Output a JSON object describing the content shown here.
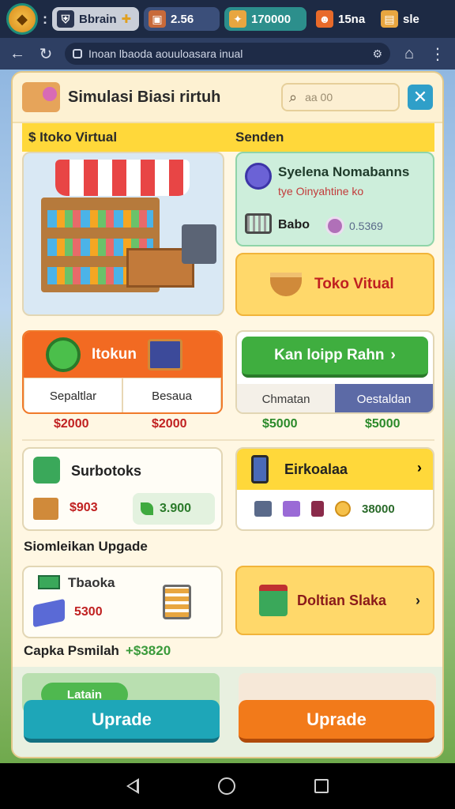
{
  "status_bar": {
    "resource_1": "Bbrain",
    "resource_2": "2.56",
    "resource_3": "170000",
    "resource_4": "15na",
    "resource_5": "sle"
  },
  "browser": {
    "url": "Inoan lbaoda aouuloasara inual"
  },
  "panel": {
    "title": "Simulasi Biasi rirtuh",
    "search_placeholder": "aa 00",
    "section_left": "$ Itoko Virtual",
    "section_right": "Senden"
  },
  "supplier": {
    "title": "Syelena Nomabanns",
    "subtitle": "tye Oinyahtine ko",
    "label": "Babo",
    "value": "0.5369"
  },
  "toko_card": {
    "label": "Toko Vitual"
  },
  "orange_card": {
    "title": "Itokun",
    "left_label": "Sepaltlar",
    "right_label": "Besaua",
    "left_price": "$2000",
    "right_price": "$2000"
  },
  "green_card": {
    "button_label": "Kan loipp Rahn",
    "tab_left": "Chmatan",
    "tab_right": "Oestaldan",
    "left_price": "$5000",
    "right_price": "$5000"
  },
  "subtotal_card": {
    "title": "Surbotoks",
    "price_red": "$903",
    "price_green": "3.900"
  },
  "yellow_card": {
    "title": "Eirkoalaa",
    "value": "38000"
  },
  "upgrade_section": {
    "label": "Siomleikan Upgade"
  },
  "tb_card": {
    "title": "Tbaoka",
    "price": "5300"
  },
  "dl_card": {
    "label": "Doltian Slaka"
  },
  "capka": {
    "label": "Capka Psmilah",
    "value": "+$3820"
  },
  "bottom": {
    "chip": "Latain",
    "left_button": "Uprade",
    "right_button": "Uprade"
  },
  "colors": {
    "accent_orange": "#f26a22",
    "accent_green": "#3fae3f",
    "accent_yellow": "#ffd83a",
    "accent_teal": "#1ea6b8"
  }
}
